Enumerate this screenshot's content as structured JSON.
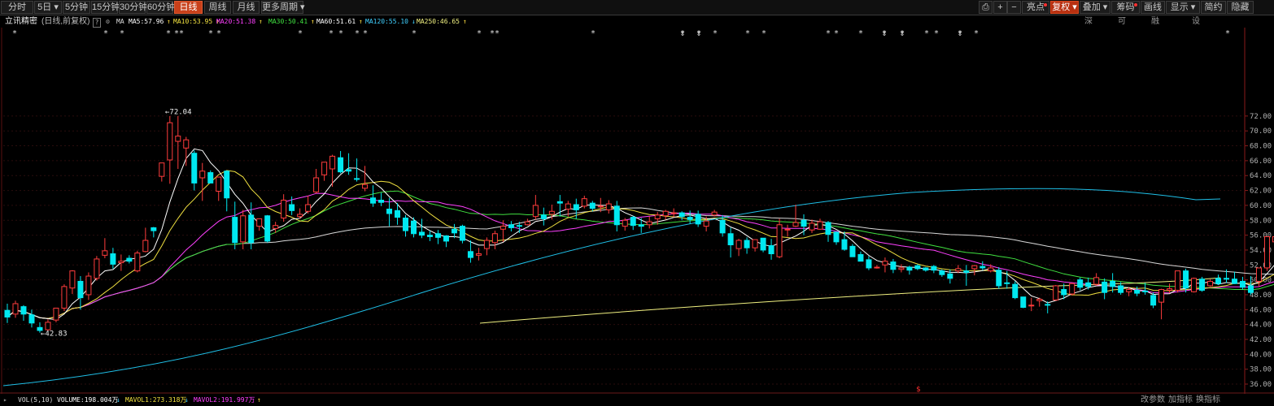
{
  "toolbar": {
    "left": [
      "分时",
      "5日 ▾",
      "5分钟",
      "15分钟",
      "30分钟",
      "60分钟",
      "日线",
      "周线",
      "月线",
      "更多周期 ▾"
    ],
    "right": [
      "亮点",
      "复权 ▾",
      "叠加 ▾",
      "筹码",
      "画线",
      "显示 ▾",
      "简约",
      "隐藏"
    ],
    "icons": [
      "export-icon",
      "plus-icon",
      "minus-icon"
    ]
  },
  "info": {
    "name": "立讯精密",
    "period": "(日线,前复权)",
    "help": "?",
    "ma_label": "MA",
    "ma": [
      {
        "text": "MA5:57.96",
        "color": "#ffffff",
        "arrow": "↑"
      },
      {
        "text": "MA10:53.95",
        "color": "#f0e040",
        "arrow": "↑"
      },
      {
        "text": "MA20:51.38",
        "color": "#ff40ff",
        "arrow": "↑"
      },
      {
        "text": "MA30:50.41",
        "color": "#40e040",
        "arrow": "↑"
      },
      {
        "text": "MA60:51.61",
        "color": "#ffffff",
        "arrow": "↑"
      },
      {
        "text": "MA120:55.10",
        "color": "#40d0ff",
        "arrow": "↓"
      },
      {
        "text": "MA250:46.65",
        "color": "#f0f080",
        "arrow": "↑"
      }
    ]
  },
  "right_tools": [
    "深股通",
    "可转债",
    "融资融券",
    "设置均线 ▾"
  ],
  "bottom": {
    "vol": "VOL(5,10)",
    "volume": "VOLUME:198.004万",
    "volume_arrow": "↓",
    "mavol1": "MAVOL1:273.318万",
    "mavol1_arrow": "↓",
    "mavol2": "MAVOL2:191.997万",
    "mavol2_arrow": "↑",
    "tools": [
      "改参数",
      "加指标",
      "换指标"
    ]
  },
  "chart_data": {
    "type": "candlestick",
    "y_ticks": [
      36,
      38,
      40,
      42,
      44,
      46,
      48,
      50,
      52,
      54,
      56,
      58,
      60,
      62,
      64,
      66,
      68,
      70,
      72
    ],
    "high_label": "72.04",
    "low_label": "42.83",
    "colors": {
      "up": "#ff3c3c",
      "down": "#00e8f0",
      "ma5": "#ffffff",
      "ma10": "#f0e040",
      "ma20": "#ff40ff",
      "ma30": "#40e040",
      "ma60": "#d8d8d8",
      "ma120": "#1fc0e8",
      "ma250": "#f0f080"
    },
    "candles": [
      [
        45.9,
        46.8,
        44.2,
        45.0
      ],
      [
        45.4,
        47.2,
        44.9,
        46.8
      ],
      [
        46.4,
        46.6,
        44.5,
        45.4
      ],
      [
        45.3,
        46.0,
        43.6,
        44.2
      ],
      [
        43.6,
        44.3,
        42.9,
        43.2
      ],
      [
        43.3,
        44.7,
        43.1,
        44.3
      ],
      [
        44.6,
        46.2,
        44.3,
        46.2
      ],
      [
        46.2,
        49.4,
        45.8,
        49.1
      ],
      [
        48.9,
        51.3,
        48.1,
        51.2
      ],
      [
        49.8,
        50.5,
        46.0,
        47.6
      ],
      [
        48.0,
        51.0,
        47.3,
        50.5
      ],
      [
        50.2,
        53.2,
        49.9,
        52.8
      ],
      [
        53.3,
        55.6,
        52.9,
        53.9
      ],
      [
        53.5,
        54.3,
        51.5,
        52.1
      ],
      [
        52.3,
        53.4,
        51.2,
        52.5
      ],
      [
        52.9,
        53.3,
        52.2,
        52.5
      ],
      [
        51.2,
        53.9,
        51.0,
        53.6
      ],
      [
        53.8,
        57.0,
        53.7,
        55.3
      ],
      [
        57.0,
        57.1,
        55.7,
        56.6
      ],
      [
        63.9,
        65.0,
        63.2,
        65.7
      ],
      [
        66.1,
        72.0,
        62.9,
        71.1
      ],
      [
        68.6,
        72.0,
        64.9,
        69.3
      ],
      [
        67.7,
        69.2,
        65.3,
        68.8
      ],
      [
        67.0,
        67.4,
        62.0,
        63.0
      ],
      [
        63.7,
        65.7,
        60.6,
        64.6
      ],
      [
        64.4,
        64.7,
        63.0,
        63.0
      ],
      [
        61.9,
        63.8,
        60.6,
        63.8
      ],
      [
        64.6,
        64.7,
        59.2,
        61.0
      ],
      [
        58.4,
        60.5,
        54.1,
        55.0
      ],
      [
        55.1,
        59.4,
        54.1,
        58.6
      ],
      [
        58.7,
        60.4,
        54.1,
        55.0
      ],
      [
        57.2,
        58.2,
        56.6,
        58.2
      ],
      [
        58.6,
        58.7,
        55.0,
        55.2
      ],
      [
        56.9,
        57.8,
        56.3,
        57.3
      ],
      [
        58.3,
        61.5,
        57.8,
        60.7
      ],
      [
        60.1,
        61.2,
        58.7,
        59.3
      ],
      [
        58.5,
        59.6,
        58.2,
        58.8
      ],
      [
        59.2,
        61.3,
        58.9,
        60.1
      ],
      [
        61.8,
        64.9,
        61.6,
        63.7
      ],
      [
        64.1,
        65.2,
        63.3,
        65.8
      ],
      [
        64.9,
        66.8,
        62.5,
        66.6
      ],
      [
        66.4,
        67.3,
        64.3,
        64.5
      ],
      [
        64.8,
        67.0,
        64.1,
        64.6
      ],
      [
        63.6,
        66.3,
        63.2,
        63.5
      ],
      [
        62.3,
        65.3,
        61.9,
        62.8
      ],
      [
        61.0,
        62.7,
        59.8,
        60.3
      ],
      [
        60.7,
        61.7,
        59.9,
        60.4
      ],
      [
        59.5,
        61.0,
        57.2,
        58.9
      ],
      [
        59.3,
        60.3,
        57.4,
        58.4
      ],
      [
        58.3,
        58.7,
        55.8,
        56.6
      ],
      [
        57.9,
        58.4,
        55.7,
        56.2
      ],
      [
        56.4,
        58.2,
        55.6,
        56.0
      ],
      [
        56.0,
        56.6,
        55.2,
        55.8
      ],
      [
        56.2,
        56.7,
        54.8,
        55.7
      ],
      [
        55.9,
        56.0,
        54.4,
        55.2
      ],
      [
        56.8,
        57.5,
        55.6,
        56.3
      ],
      [
        57.2,
        57.4,
        54.9,
        55.3
      ],
      [
        53.8,
        55.3,
        52.3,
        53.0
      ],
      [
        53.3,
        54.3,
        52.6,
        53.5
      ],
      [
        54.2,
        55.7,
        53.3,
        55.3
      ],
      [
        55.0,
        56.6,
        54.1,
        56.2
      ],
      [
        56.8,
        58.0,
        55.1,
        57.2
      ],
      [
        57.4,
        57.9,
        56.5,
        57.0
      ],
      [
        57.3,
        57.8,
        56.3,
        57.2
      ],
      [
        57.4,
        58.2,
        57.3,
        57.8
      ],
      [
        58.5,
        61.4,
        58.1,
        60.0
      ],
      [
        58.7,
        59.7,
        57.3,
        58.2
      ],
      [
        58.8,
        60.1,
        58.1,
        59.2
      ],
      [
        60.5,
        61.4,
        58.5,
        60.3
      ],
      [
        59.5,
        60.6,
        58.5,
        60.2
      ],
      [
        60.1,
        60.9,
        58.2,
        59.4
      ],
      [
        59.9,
        61.3,
        59.6,
        60.9
      ],
      [
        60.3,
        60.6,
        59.2,
        59.6
      ],
      [
        59.9,
        61.0,
        59.1,
        59.9
      ],
      [
        59.4,
        60.7,
        58.9,
        60.2
      ],
      [
        59.9,
        60.6,
        56.5,
        57.4
      ],
      [
        57.2,
        58.3,
        56.6,
        58.0
      ],
      [
        58.4,
        58.6,
        56.7,
        57.3
      ],
      [
        57.4,
        58.3,
        56.3,
        57.2
      ],
      [
        57.4,
        58.5,
        56.9,
        57.8
      ],
      [
        58.2,
        59.1,
        57.4,
        58.7
      ],
      [
        58.6,
        59.4,
        58.1,
        59.2
      ],
      [
        59.0,
        59.6,
        58.4,
        59.0
      ],
      [
        59.0,
        59.2,
        58.0,
        58.5
      ],
      [
        58.4,
        59.3,
        57.5,
        58.1
      ],
      [
        58.8,
        59.3,
        57.1,
        57.5
      ],
      [
        57.2,
        58.5,
        56.5,
        57.9
      ],
      [
        58.7,
        59.4,
        58.5,
        59.1
      ],
      [
        58.0,
        58.7,
        55.8,
        56.3
      ],
      [
        56.2,
        57.0,
        53.0,
        54.7
      ],
      [
        54.2,
        55.5,
        53.2,
        55.3
      ],
      [
        55.3,
        55.7,
        53.5,
        54.3
      ],
      [
        54.3,
        55.4,
        53.8,
        55.4
      ],
      [
        55.6,
        55.6,
        53.7,
        54.0
      ],
      [
        54.6,
        55.5,
        52.7,
        53.5
      ],
      [
        53.1,
        58.2,
        52.9,
        57.4
      ],
      [
        56.7,
        57.4,
        55.8,
        56.8
      ],
      [
        57.2,
        60.1,
        57.1,
        57.7
      ],
      [
        58.0,
        58.8,
        56.0,
        57.2
      ],
      [
        56.7,
        58.1,
        56.3,
        57.6
      ],
      [
        56.8,
        58.2,
        56.7,
        57.8
      ],
      [
        57.7,
        57.9,
        55.1,
        56.1
      ],
      [
        56.4,
        56.5,
        54.7,
        55.1
      ],
      [
        55.4,
        56.5,
        53.9,
        54.1
      ],
      [
        54.5,
        54.8,
        53.1,
        53.1
      ],
      [
        53.4,
        53.8,
        52.5,
        52.5
      ],
      [
        52.7,
        53.2,
        51.3,
        51.6
      ],
      [
        51.7,
        52.0,
        51.5,
        51.7
      ],
      [
        52.0,
        53.0,
        51.0,
        52.5
      ],
      [
        52.4,
        52.8,
        50.9,
        51.4
      ],
      [
        51.4,
        52.1,
        51.0,
        51.6
      ],
      [
        51.7,
        51.9,
        50.7,
        51.3
      ],
      [
        51.9,
        52.1,
        51.3,
        51.5
      ],
      [
        51.6,
        51.7,
        51.1,
        51.3
      ],
      [
        51.8,
        52.0,
        50.9,
        51.3
      ],
      [
        51.2,
        51.4,
        50.4,
        50.7
      ],
      [
        50.8,
        51.4,
        49.5,
        50.2
      ],
      [
        51.2,
        52.0,
        50.9,
        51.5
      ],
      [
        51.2,
        52.0,
        49.2,
        51.0
      ],
      [
        51.5,
        52.0,
        50.6,
        51.9
      ],
      [
        51.8,
        52.5,
        51.3,
        51.6
      ],
      [
        51.2,
        52.1,
        51.0,
        51.6
      ],
      [
        51.3,
        51.7,
        48.8,
        49.2
      ],
      [
        49.6,
        51.2,
        48.8,
        49.5
      ],
      [
        49.4,
        49.8,
        47.4,
        47.6
      ],
      [
        47.7,
        47.7,
        46.2,
        46.3
      ],
      [
        46.6,
        47.6,
        45.8,
        46.6
      ],
      [
        47.2,
        47.6,
        46.4,
        47.4
      ],
      [
        46.7,
        47.1,
        45.5,
        46.6
      ],
      [
        47.3,
        49.3,
        47.2,
        49.2
      ],
      [
        48.7,
        49.5,
        47.4,
        48.0
      ],
      [
        48.1,
        49.6,
        47.9,
        49.5
      ],
      [
        50.0,
        50.3,
        48.6,
        49.0
      ],
      [
        49.6,
        50.3,
        48.7,
        49.1
      ],
      [
        49.4,
        50.9,
        49.2,
        50.3
      ],
      [
        49.7,
        50.2,
        47.4,
        48.3
      ],
      [
        49.8,
        50.9,
        48.3,
        49.1
      ],
      [
        49.2,
        49.7,
        48.0,
        48.3
      ],
      [
        48.4,
        49.0,
        47.8,
        48.7
      ],
      [
        48.6,
        49.1,
        47.8,
        48.2
      ],
      [
        48.5,
        49.6,
        48.0,
        48.4
      ],
      [
        47.9,
        48.3,
        46.2,
        46.6
      ],
      [
        47.0,
        48.8,
        44.7,
        48.7
      ],
      [
        48.6,
        49.5,
        48.2,
        48.8
      ],
      [
        48.6,
        51.1,
        48.3,
        51.2
      ],
      [
        51.2,
        51.5,
        48.3,
        48.9
      ],
      [
        48.4,
        50.3,
        48.3,
        50.2
      ],
      [
        50.1,
        50.4,
        48.4,
        48.6
      ],
      [
        49.2,
        50.1,
        49.1,
        49.8
      ],
      [
        50.2,
        50.7,
        49.3,
        49.5
      ],
      [
        50.2,
        51.4,
        49.6,
        50.1
      ],
      [
        50.1,
        51.1,
        49.5,
        49.5
      ],
      [
        49.8,
        50.4,
        48.7,
        49.0
      ],
      [
        49.2,
        50.5,
        48.0,
        48.3
      ],
      [
        49.8,
        51.6,
        49.1,
        51.6
      ],
      [
        51.6,
        55.7,
        51.2,
        55.8
      ],
      [
        55.1,
        58.7,
        54.5,
        55.8
      ],
      [
        57.3,
        59.8,
        56.5,
        59.2
      ],
      [
        58.2,
        59.8,
        57.0,
        58.8
      ],
      [
        59.1,
        61.0,
        58.5,
        59.3
      ],
      [
        59.3,
        61.1,
        58.4,
        59.0
      ]
    ],
    "markers_x": [
      18,
      130,
      150,
      207,
      217,
      223,
      259,
      269,
      369,
      407,
      419,
      439,
      449,
      509,
      589,
      605,
      611,
      729,
      839,
      859,
      879,
      919,
      939,
      1018,
      1028,
      1058,
      1087,
      1109,
      1139,
      1151,
      1180,
      1200,
      1509
    ]
  }
}
